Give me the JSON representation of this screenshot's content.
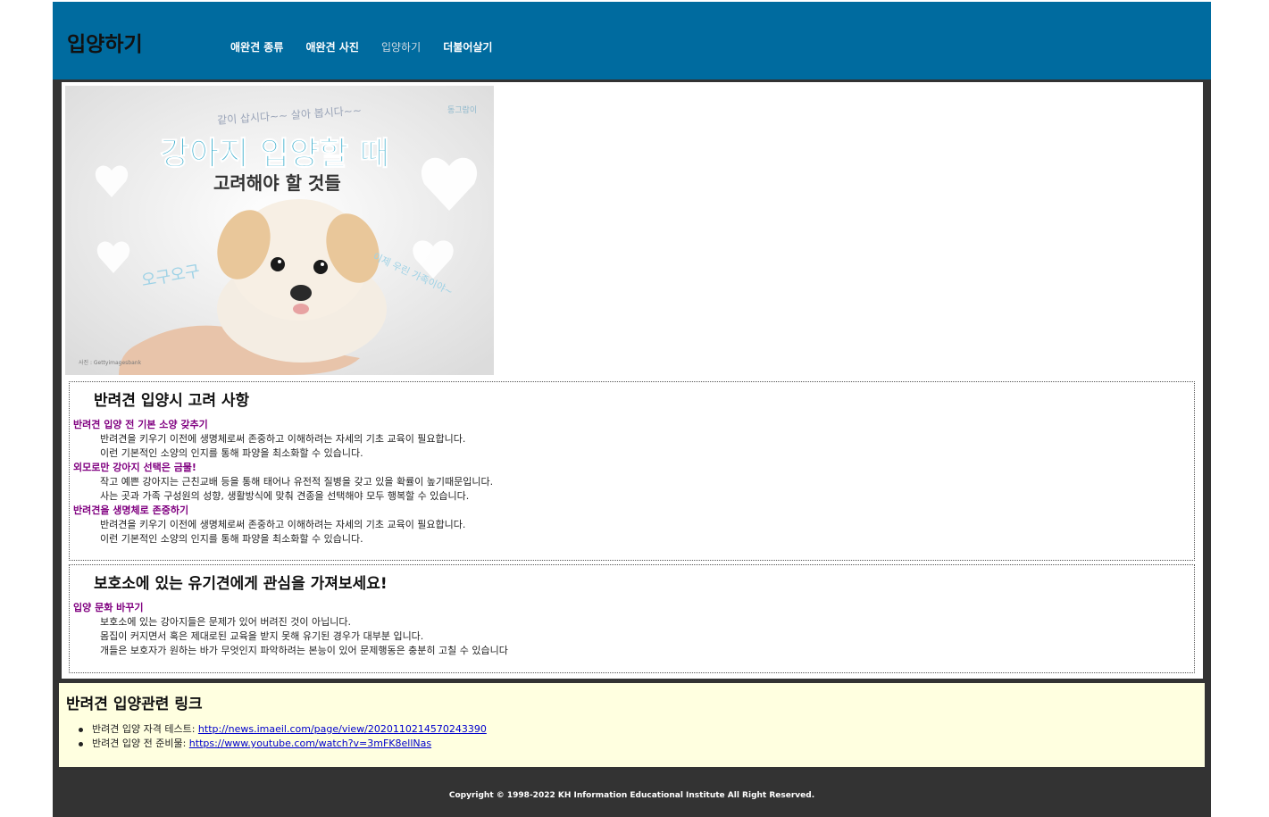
{
  "header": {
    "logo": "입양하기",
    "nav": [
      {
        "label": "애완견 종류"
      },
      {
        "label": "애완견 사진"
      },
      {
        "label": "입양하기"
      },
      {
        "label": "더불어살기"
      }
    ]
  },
  "hero": {
    "top_text": "같이 삽시다~~ 살아 봅시다~~",
    "title_line1": "강아지 입양할 때",
    "title_line2": "고려해야 할 것들",
    "left_text": "오구오구",
    "right_text": "이제 우린 가족이야~",
    "brand": "동그람이",
    "credit": "사진 : Gettyimagesbank"
  },
  "section1": {
    "title": "반려견 입양시 고려 사항",
    "items": [
      {
        "sub": "반려견 입양 전 기본 소양 갖추기",
        "lines": [
          "반려견을 키우기 이전에 생명체로써 존중하고 이해하려는 자세의 기초 교육이 필요합니다.",
          "이런 기본적인 소양의 인지를 통해 파양을 최소화할 수 있습니다."
        ]
      },
      {
        "sub": "외모로만 강아지 선택은 금물!",
        "lines": [
          "작고 예쁜 강아지는 근친교배 등을 통해 태어나 유전적 질병을 갖고 있을 확률이 높기때문입니다.",
          "사는 곳과 가족 구성원의 성향, 생활방식에 맞춰 견종을 선택해야 모두 행복할 수 있습니다."
        ]
      },
      {
        "sub": "반려견을 생명체로 존중하기",
        "lines": [
          "반려견을 키우기 이전에 생명체로써 존중하고 이해하려는 자세의 기초 교육이 필요합니다.",
          "이런 기본적인 소양의 인지를 통해 파양을 최소화할 수 있습니다."
        ]
      }
    ]
  },
  "section2": {
    "title": "보호소에 있는 유기견에게 관심을 가져보세요!",
    "items": [
      {
        "sub": "입양 문화 바꾸기",
        "lines": [
          "보호소에 있는 강아지들은 문제가 있어 버려진 것이 아닙니다.",
          "몸집이 커지면서 혹은 제대로된 교육을 받지 못해 유기된 경우가 대부분 입니다.",
          "개들은 보호자가 원하는 바가 무엇인지 파악하려는 본능이 있어 문제행동은 충분히 고칠 수 있습니다"
        ]
      }
    ]
  },
  "links": {
    "title": "반려견 입양관련 링크",
    "items": [
      {
        "label": "반려견 입양 자격 테스트: ",
        "url": "http://news.imaeil.com/page/view/2020110214570243390"
      },
      {
        "label": "반려견 입양 전 준비물: ",
        "url": "https://www.youtube.com/watch?v=3mFK8ellNas"
      }
    ]
  },
  "footer": {
    "copyright": "Copyright © 1998-2022 KH Information Educational Institute All Right Reserved."
  },
  "colors": {
    "header_bg": "#006b9f",
    "frame_bg": "#333333",
    "links_bg": "#ffffe0",
    "subtitle": "#800080",
    "link": "#0000cc"
  }
}
